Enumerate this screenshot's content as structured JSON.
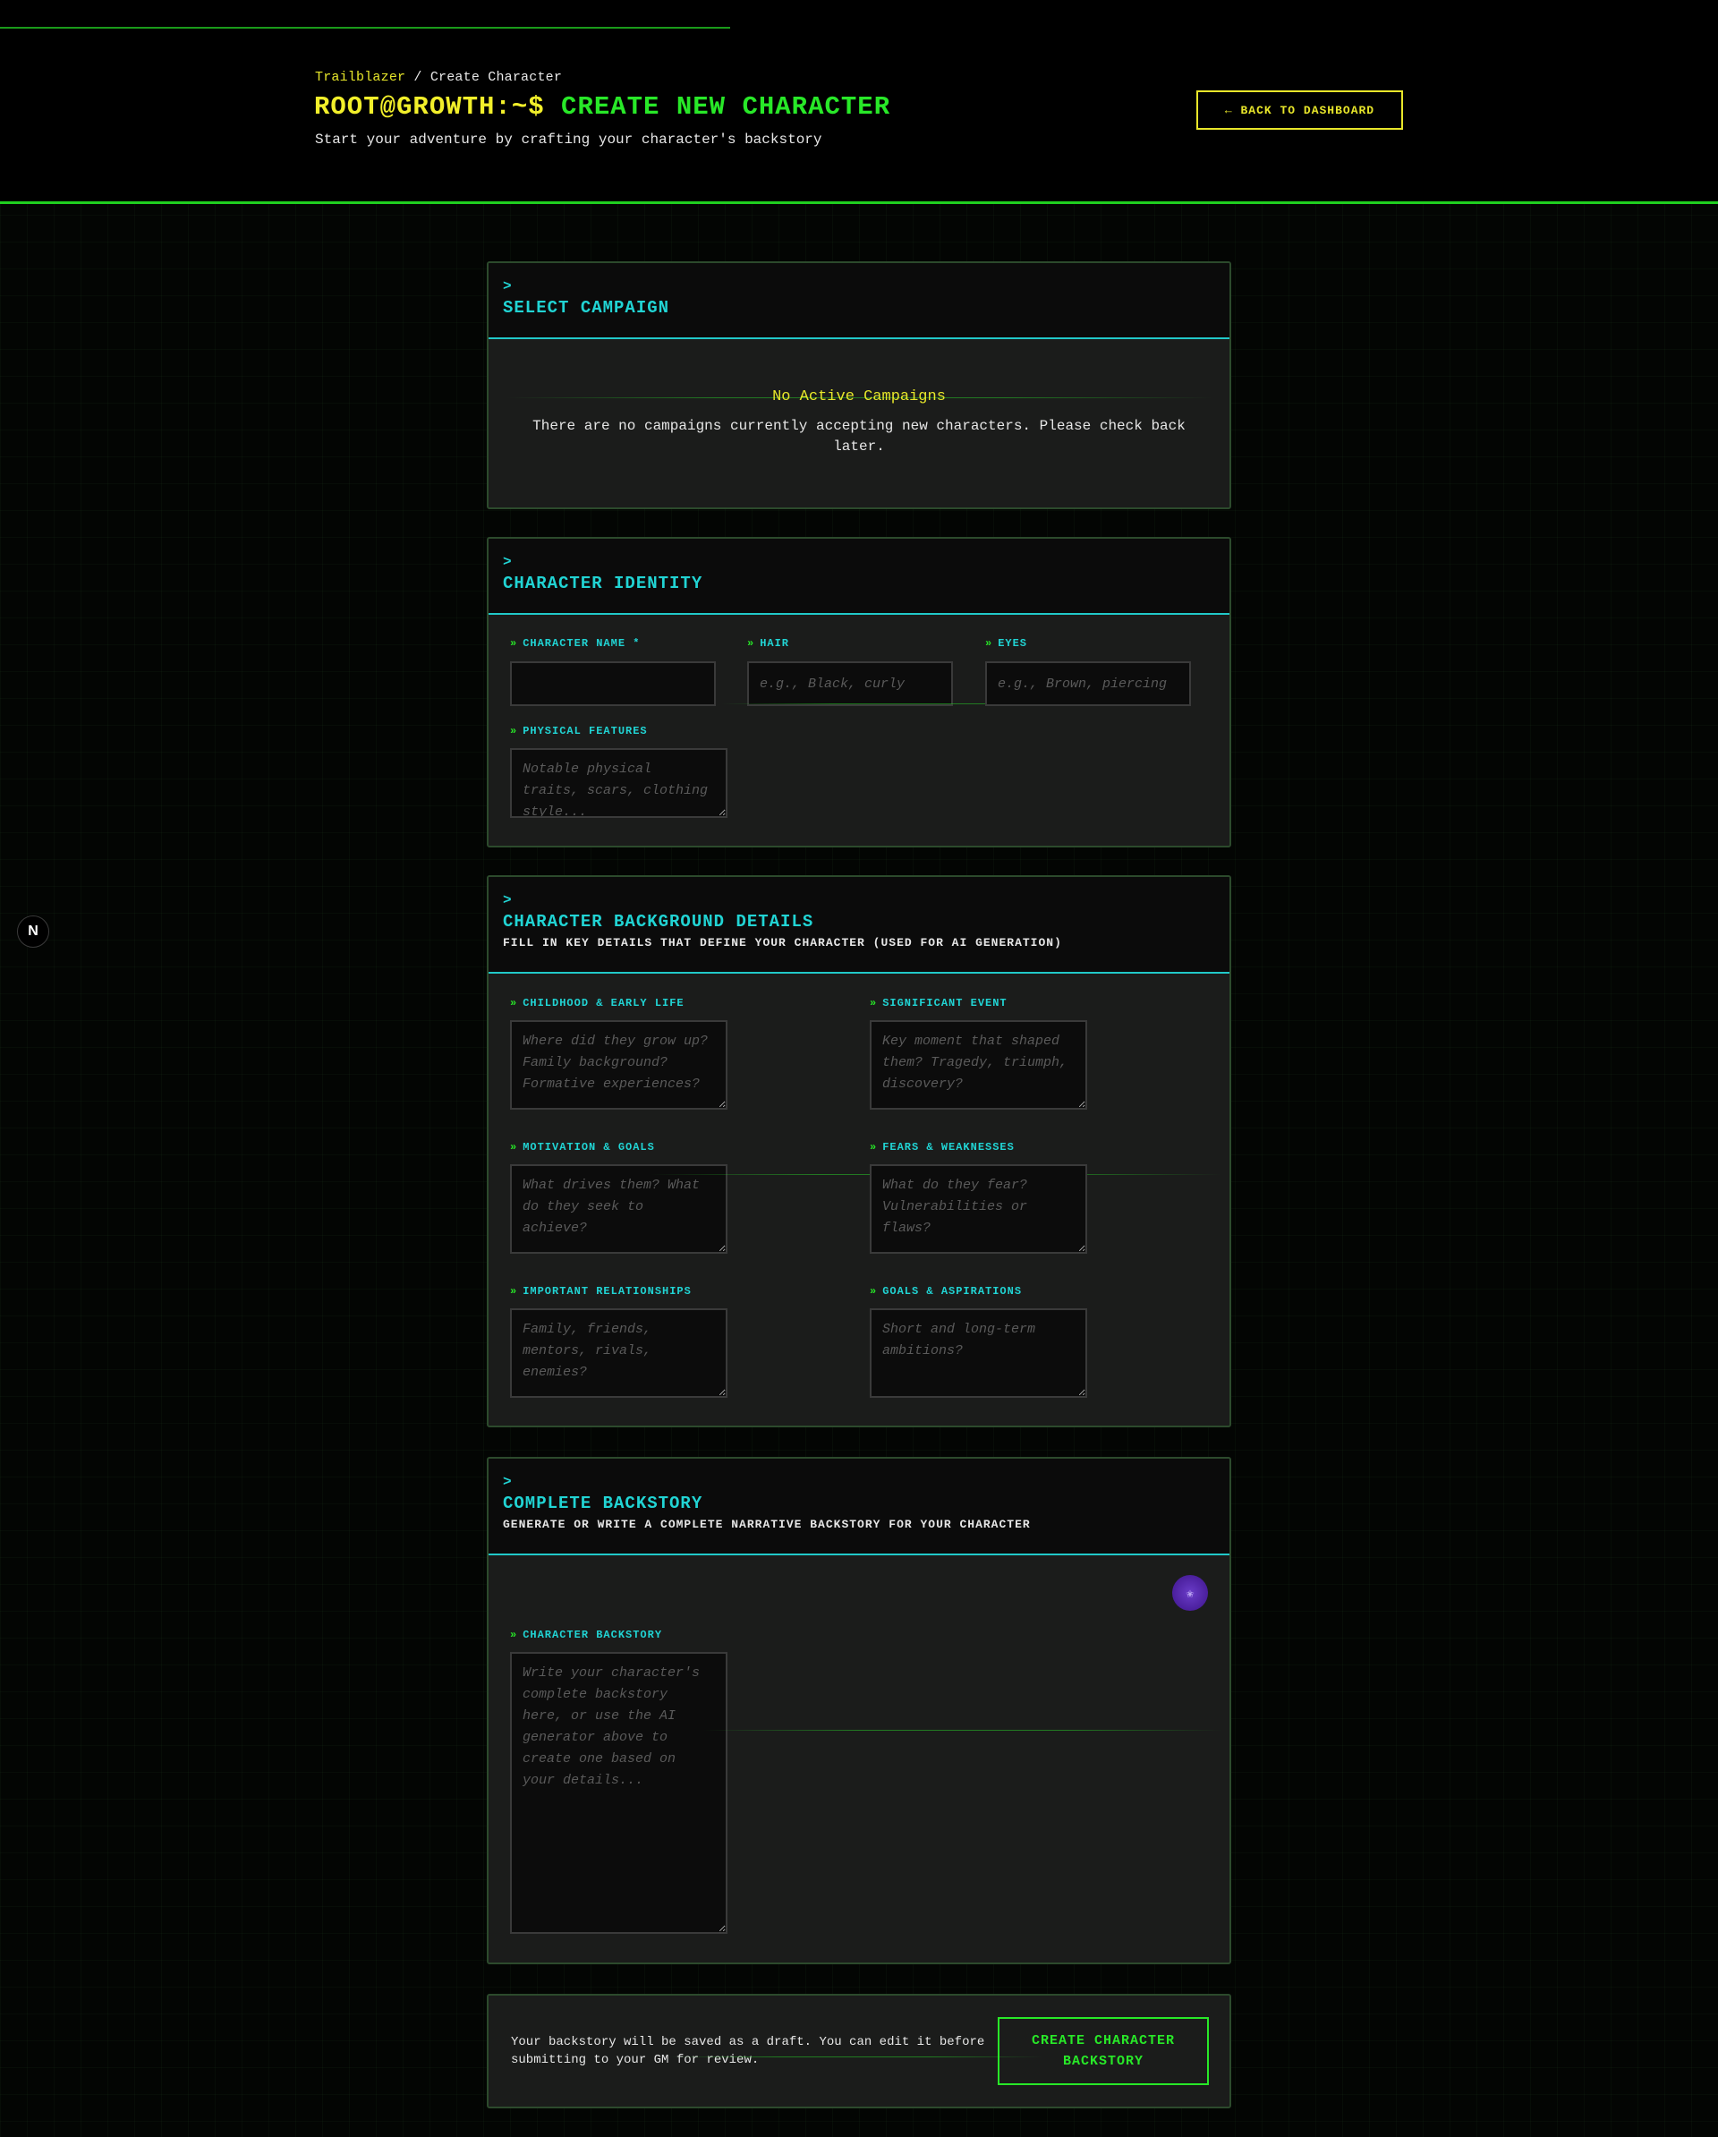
{
  "header": {
    "breadcrumb": {
      "home": "Trailblazer",
      "separator": " / ",
      "current": "Create Character"
    },
    "prompt": "ROOT@GROWTH:~$",
    "title": "CREATE NEW CHARACTER",
    "subtitle": "Start your adventure by crafting your character's backstory",
    "back_button": "← BACK TO DASHBOARD"
  },
  "badge": {
    "letter": "N"
  },
  "campaign": {
    "caret": ">",
    "title": "SELECT CAMPAIGN",
    "empty_title": "No Active Campaigns",
    "empty_body": "There are no campaigns currently accepting new characters. Please check back later."
  },
  "identity": {
    "caret": ">",
    "title": "CHARACTER IDENTITY",
    "fields": {
      "name": {
        "label": "CHARACTER NAME *",
        "value": "",
        "placeholder": ""
      },
      "hair": {
        "label": "HAIR",
        "value": "",
        "placeholder": "e.g., Black, curly"
      },
      "eyes": {
        "label": "EYES",
        "value": "",
        "placeholder": "e.g., Brown, piercing"
      },
      "physical": {
        "label": "PHYSICAL FEATURES",
        "value": "",
        "placeholder": "Notable physical traits, scars, clothing style..."
      }
    }
  },
  "background": {
    "caret": ">",
    "title": "CHARACTER BACKGROUND DETAILS",
    "description": "FILL IN KEY DETAILS THAT DEFINE YOUR CHARACTER (USED FOR AI GENERATION)",
    "fields": {
      "childhood": {
        "label": "CHILDHOOD & EARLY LIFE",
        "placeholder": "Where did they grow up? Family background? Formative experiences?"
      },
      "event": {
        "label": "SIGNIFICANT EVENT",
        "placeholder": "Key moment that shaped them? Tragedy, triumph, discovery?"
      },
      "motivation": {
        "label": "MOTIVATION & GOALS",
        "placeholder": "What drives them? What do they seek to achieve?"
      },
      "fears": {
        "label": "FEARS & WEAKNESSES",
        "placeholder": "What do they fear? Vulnerabilities or flaws?"
      },
      "relationships": {
        "label": "IMPORTANT RELATIONSHIPS",
        "placeholder": "Family, friends, mentors, rivals, enemies?"
      },
      "aspirations": {
        "label": "GOALS & ASPIRATIONS",
        "placeholder": "Short and long-term ambitions?"
      }
    }
  },
  "backstory": {
    "caret": ">",
    "title": "COMPLETE BACKSTORY",
    "description": "GENERATE OR WRITE A COMPLETE NARRATIVE BACKSTORY FOR YOUR CHARACTER",
    "ai_icon": "sparkle-icon",
    "ai_glyph": "✬",
    "label": "CHARACTER BACKSTORY",
    "placeholder": "Write your character's complete backstory here, or use the AI generator above to create one based on your details..."
  },
  "footer": {
    "note": "Your backstory will be saved as a draft. You can edit it before submitting to your GM for review.",
    "create_button": "CREATE CHARACTER BACKSTORY"
  },
  "colors": {
    "accent_green": "#28e828",
    "accent_yellow": "#e8e62a",
    "accent_cyan": "#21d4d4",
    "panel_bg": "#1b1c1b",
    "ai_purple": "#5a2eb4"
  }
}
